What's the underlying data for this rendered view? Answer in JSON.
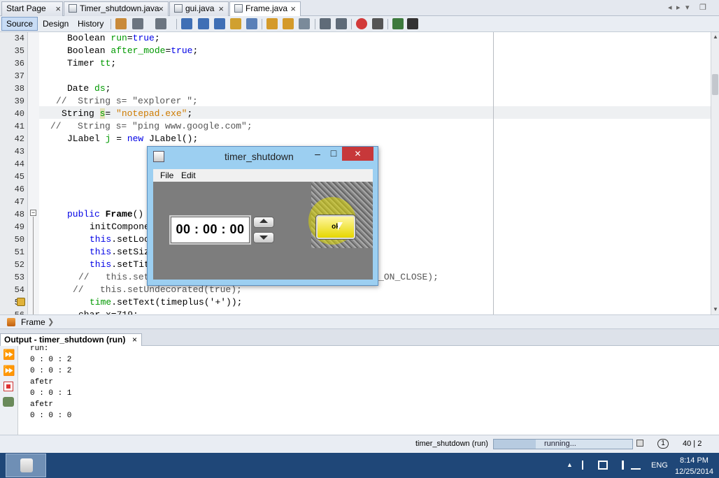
{
  "tabs": [
    {
      "label": "Start Page"
    },
    {
      "label": "Timer_shutdown.java"
    },
    {
      "label": "gui.java"
    },
    {
      "label": "Frame.java"
    }
  ],
  "tab_close_glyph": "×",
  "tab_nav": {
    "left": "◂",
    "right": "▸",
    "menu": "▾",
    "restore": "❐"
  },
  "toolbar": {
    "source_label": "Source",
    "design_label": "Design",
    "history_label": "History"
  },
  "editor": {
    "line_numbers": [
      "34",
      "35",
      "36",
      "37",
      "38",
      "39",
      "40",
      "41",
      "42",
      "43",
      "44",
      "45",
      "46",
      "47",
      "48",
      "49",
      "50",
      "51",
      "52",
      "53",
      "54",
      "55",
      "56"
    ],
    "lines": {
      "l34": {
        "type": "Boolean ",
        "var": "run",
        "rest": "=",
        "kw": "true",
        "end": ";"
      },
      "l35": {
        "type": "Boolean ",
        "var": "after_mode",
        "rest": "=",
        "kw": "true",
        "end": ";"
      },
      "l36": {
        "type": "Timer ",
        "var": "tt",
        "end": ";"
      },
      "l38": {
        "type": "Date ",
        "var": "ds",
        "end": ";"
      },
      "l39": "//  String s= \"explorer \";",
      "l40": {
        "type": "String ",
        "var": "s",
        "rest": "= ",
        "str": "\"notepad.exe\"",
        "end": ";"
      },
      "l41": "//   String s= \"ping www.google.com\";",
      "l42": {
        "type": "JLabel ",
        "var": "j",
        "rest": " = ",
        "kw": "new",
        "end": " JLabel();"
      },
      "l48": {
        "kw": "public ",
        "name": "Frame",
        "end": "() {"
      },
      "l49": "initComponents();",
      "l50": {
        "kw": "this",
        "end": ".setLocation("
      },
      "l51": {
        "kw": "this",
        "end": ".setSize("
      },
      "l52": {
        "kw": "this",
        "end": ".setTitle("
      },
      "l53": {
        "pre": "//   this.setDefaultCloseOperation(WindowConstants.HIDE_ON_CLOSE);",
        "tail": "onstants.HIDE_ON_CLOSE);"
      },
      "l54": "//   this.setUndecorated(true);",
      "l55": {
        "var": "time",
        "end": ".setText(timeplus('+'));"
      },
      "l56": "char x=719;"
    }
  },
  "navbar": {
    "breadcrumb": "Frame",
    "arrow": "❯"
  },
  "output": {
    "tab_label": "Output - timer_shutdown (run)",
    "lines": [
      "run:",
      "0 : 0 : 2",
      "0 : 0 : 2",
      "afetr",
      "0 : 0 : 1",
      "afetr",
      "0 : 0 : 0"
    ]
  },
  "statusbar": {
    "project": "timer_shutdown (run)",
    "progress_text": "running...",
    "notifications": "1",
    "position": "40 | 2"
  },
  "taskbar": {
    "lang": "ENG",
    "time": "8:14 PM",
    "date": "12/25/2014",
    "tray_expand": "▲"
  },
  "app_window": {
    "title": "timer_shutdown",
    "menu_file": "File",
    "menu_edit": "Edit",
    "time_display": "00 : 00 : 00",
    "ok_label": "ok",
    "minimize": "–",
    "maximize": "□",
    "close": "✕"
  },
  "colors": {
    "keyword": "#0000e6",
    "string": "#ce7b00",
    "field": "#009900",
    "taskbar": "#1f4778",
    "close_button": "#c7383a",
    "ok_button": "#e6d700"
  }
}
